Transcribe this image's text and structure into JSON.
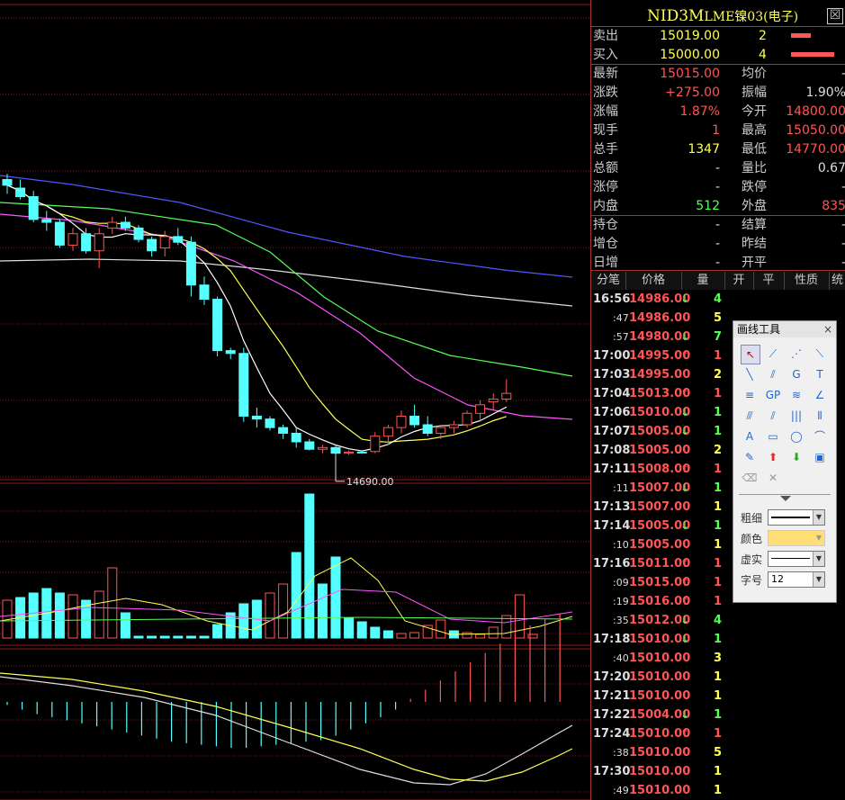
{
  "title": {
    "symbol": "NID3M",
    "name": "LME镍03(电子)",
    "close_glyph": "☒"
  },
  "order_book": [
    {
      "label": "卖出",
      "price": "15019.00",
      "qty": "2",
      "bar": 0.45
    },
    {
      "label": "买入",
      "price": "15000.00",
      "qty": "4",
      "bar": 1.0
    }
  ],
  "quote_rows": [
    {
      "l1": "最新",
      "v1": "15015.00",
      "c1": "red",
      "l2": "均价",
      "v2": "-",
      "c2": "wht"
    },
    {
      "l1": "涨跌",
      "v1": "+275.00",
      "c1": "red",
      "l2": "振幅",
      "v2": "1.90%",
      "c2": "wht"
    },
    {
      "l1": "涨幅",
      "v1": "1.87%",
      "c1": "red",
      "l2": "今开",
      "v2": "14800.00",
      "c2": "red"
    },
    {
      "l1": "现手",
      "v1": "1",
      "c1": "red",
      "l2": "最高",
      "v2": "15050.00",
      "c2": "red"
    },
    {
      "l1": "总手",
      "v1": "1347",
      "c1": "yel",
      "l2": "最低",
      "v2": "14770.00",
      "c2": "red"
    },
    {
      "l1": "总额",
      "v1": "-",
      "c1": "wht",
      "l2": "量比",
      "v2": "0.67",
      "c2": "wht"
    },
    {
      "l1": "涨停",
      "v1": "-",
      "c1": "wht",
      "l2": "跌停",
      "v2": "-",
      "c2": "wht"
    },
    {
      "l1": "内盘",
      "v1": "512",
      "c1": "grn",
      "l2": "外盘",
      "v2": "835",
      "c2": "red"
    },
    {
      "l1": "持仓",
      "v1": "-",
      "c1": "wht",
      "l2": "结算",
      "v2": "-",
      "c2": "wht"
    },
    {
      "l1": "增仓",
      "v1": "-",
      "c1": "wht",
      "l2": "昨结",
      "v2": "-",
      "c2": "wht"
    },
    {
      "l1": "日增",
      "v1": "-",
      "c1": "wht",
      "l2": "开平",
      "v2": "-",
      "c2": "wht"
    }
  ],
  "tabs": [
    "分笔",
    "价格",
    "量",
    "开",
    "平",
    "性质",
    "统"
  ],
  "trades": [
    {
      "time": "16:56",
      "price": "14986.00",
      "dir": "down",
      "vol": "4"
    },
    {
      "time": ":47",
      "price": "14986.00",
      "dir": "",
      "vol": "5"
    },
    {
      "time": ":57",
      "price": "14980.00",
      "dir": "down",
      "vol": "7"
    },
    {
      "time": "17:00",
      "price": "14995.00",
      "dir": "up",
      "vol": "1"
    },
    {
      "time": "17:03",
      "price": "14995.00",
      "dir": "",
      "vol": "2"
    },
    {
      "time": "17:04",
      "price": "15013.00",
      "dir": "up",
      "vol": "1"
    },
    {
      "time": "17:06",
      "price": "15010.00",
      "dir": "down",
      "vol": "1"
    },
    {
      "time": "17:07",
      "price": "15005.00",
      "dir": "down",
      "vol": "1"
    },
    {
      "time": "17:08",
      "price": "15005.00",
      "dir": "",
      "vol": "2"
    },
    {
      "time": "17:11",
      "price": "15008.00",
      "dir": "up",
      "vol": "1"
    },
    {
      "time": ":11",
      "price": "15007.00",
      "dir": "down",
      "vol": "1"
    },
    {
      "time": "17:13",
      "price": "15007.00",
      "dir": "",
      "vol": "1"
    },
    {
      "time": "17:14",
      "price": "15005.00",
      "dir": "down",
      "vol": "1"
    },
    {
      "time": ":10",
      "price": "15005.00",
      "dir": "",
      "vol": "1"
    },
    {
      "time": "17:16",
      "price": "15011.00",
      "dir": "up",
      "vol": "1"
    },
    {
      "time": ":09",
      "price": "15015.00",
      "dir": "up",
      "vol": "1"
    },
    {
      "time": ":19",
      "price": "15016.00",
      "dir": "up",
      "vol": "1"
    },
    {
      "time": ":35",
      "price": "15012.00",
      "dir": "down",
      "vol": "4"
    },
    {
      "time": "17:18",
      "price": "15010.00",
      "dir": "down",
      "vol": "1"
    },
    {
      "time": ":40",
      "price": "15010.00",
      "dir": "",
      "vol": "3"
    },
    {
      "time": "17:20",
      "price": "15010.00",
      "dir": "",
      "vol": "1"
    },
    {
      "time": "17:21",
      "price": "15010.00",
      "dir": "",
      "vol": "1"
    },
    {
      "time": "17:22",
      "price": "15004.00",
      "dir": "down",
      "vol": "1"
    },
    {
      "time": "17:24",
      "price": "15010.00",
      "dir": "up",
      "vol": "1"
    },
    {
      "time": ":38",
      "price": "15010.00",
      "dir": "",
      "vol": "5"
    },
    {
      "time": "17:30",
      "price": "15010.00",
      "dir": "",
      "vol": "1"
    },
    {
      "time": ":49",
      "price": "15010.00",
      "dir": "",
      "vol": "1"
    }
  ],
  "toolbox": {
    "title": "画线工具",
    "close": "×",
    "props": [
      {
        "label": "粗细",
        "value": ""
      },
      {
        "label": "颜色",
        "value": ""
      },
      {
        "label": "虚实",
        "value": ""
      },
      {
        "label": "字号",
        "value": "12"
      }
    ],
    "color_value": "#ffdd77"
  },
  "chart_data": {
    "type": "candlestick",
    "low_annotation": "14690.00",
    "colors": {
      "up": "#ff5555",
      "down": "#55ffff",
      "ma5": "#ffffff",
      "ma10": "#ffff55",
      "ma20": "#ff55ff",
      "ma40": "#55ff55",
      "ma60": "#5555ff",
      "ma120": "#dddddd"
    },
    "candles": [
      [
        14875,
        14885,
        14850,
        14865
      ],
      [
        14860,
        14875,
        14840,
        14845
      ],
      [
        14845,
        14855,
        14800,
        14805
      ],
      [
        14805,
        14820,
        14785,
        14800
      ],
      [
        14800,
        14805,
        14755,
        14760
      ],
      [
        14760,
        14790,
        14750,
        14780
      ],
      [
        14780,
        14790,
        14745,
        14750
      ],
      [
        14750,
        14790,
        14720,
        14780
      ],
      [
        14790,
        14810,
        14780,
        14800
      ],
      [
        14800,
        14810,
        14785,
        14790
      ],
      [
        14790,
        14795,
        14765,
        14770
      ],
      [
        14770,
        14775,
        14740,
        14750
      ],
      [
        14755,
        14785,
        14740,
        14775
      ],
      [
        14775,
        14790,
        14760,
        14765
      ],
      [
        14765,
        14775,
        14670,
        14690
      ],
      [
        14690,
        14705,
        14655,
        14665
      ],
      [
        14665,
        14670,
        14565,
        14575
      ],
      [
        14575,
        14580,
        14560,
        14570
      ],
      [
        14570,
        14580,
        14450,
        14460
      ],
      [
        14460,
        14475,
        14440,
        14455
      ],
      [
        14455,
        14460,
        14435,
        14440
      ],
      [
        14440,
        14445,
        14420,
        14430
      ],
      [
        14430,
        14440,
        14405,
        14415
      ],
      [
        14415,
        14420,
        14400,
        14402
      ],
      [
        14402,
        14410,
        14395,
        14405
      ],
      [
        14405,
        14410,
        14390,
        14395
      ],
      [
        14395,
        14400,
        14392,
        14397
      ],
      [
        14397,
        14400,
        14394,
        14396
      ],
      [
        14398,
        14432,
        14395,
        14425
      ],
      [
        14425,
        14445,
        14410,
        14440
      ],
      [
        14440,
        14470,
        14430,
        14460
      ],
      [
        14460,
        14480,
        14440,
        14445
      ],
      [
        14445,
        14460,
        14425,
        14430
      ],
      [
        14430,
        14445,
        14420,
        14440
      ],
      [
        14440,
        14452,
        14430,
        14445
      ],
      [
        14445,
        14470,
        14440,
        14465
      ],
      [
        14465,
        14488,
        14450,
        14480
      ],
      [
        14485,
        14500,
        14470,
        14490
      ],
      [
        14490,
        14525,
        14485,
        14500
      ]
    ],
    "volumes": [
      {
        "v": 42,
        "up": true
      },
      {
        "v": 45,
        "up": false
      },
      {
        "v": 50,
        "up": false
      },
      {
        "v": 55,
        "up": false
      },
      {
        "v": 50,
        "up": false
      },
      {
        "v": 48,
        "up": true
      },
      {
        "v": 42,
        "up": false
      },
      {
        "v": 52,
        "up": true
      },
      {
        "v": 78,
        "up": true
      },
      {
        "v": 28,
        "up": false
      },
      {
        "v": 2,
        "up": false
      },
      {
        "v": 2,
        "up": false
      },
      {
        "v": 2,
        "up": false
      },
      {
        "v": 2,
        "up": false
      },
      {
        "v": 2,
        "up": false
      },
      {
        "v": 2,
        "up": false
      },
      {
        "v": 15,
        "up": false
      },
      {
        "v": 28,
        "up": false
      },
      {
        "v": 38,
        "up": false
      },
      {
        "v": 42,
        "up": false
      },
      {
        "v": 50,
        "up": true
      },
      {
        "v": 60,
        "up": true
      },
      {
        "v": 95,
        "up": false
      },
      {
        "v": 160,
        "up": false
      },
      {
        "v": 60,
        "up": false
      },
      {
        "v": 90,
        "up": false
      },
      {
        "v": 22,
        "up": false
      },
      {
        "v": 18,
        "up": false
      },
      {
        "v": 12,
        "up": false
      },
      {
        "v": 8,
        "up": false
      },
      {
        "v": 5,
        "up": true
      },
      {
        "v": 6,
        "up": true
      },
      {
        "v": 14,
        "up": true
      },
      {
        "v": 20,
        "up": true
      },
      {
        "v": 8,
        "up": false
      },
      {
        "v": 6,
        "up": true
      },
      {
        "v": 4,
        "up": true
      },
      {
        "v": 12,
        "up": true
      },
      {
        "v": 25,
        "up": true
      },
      {
        "v": 48,
        "up": true
      },
      {
        "v": 4,
        "up": true
      }
    ],
    "macd": [
      -2,
      -5,
      -8,
      -10,
      -12,
      -14,
      -16,
      -18,
      -20,
      -22,
      -24,
      -26,
      -27,
      -28,
      -29,
      -30,
      -30,
      -29,
      -28,
      -27,
      -26,
      -25,
      -22,
      -18,
      -14,
      -10,
      -5,
      2,
      8,
      14,
      20,
      26,
      32,
      38,
      44,
      50,
      54,
      58
    ]
  }
}
